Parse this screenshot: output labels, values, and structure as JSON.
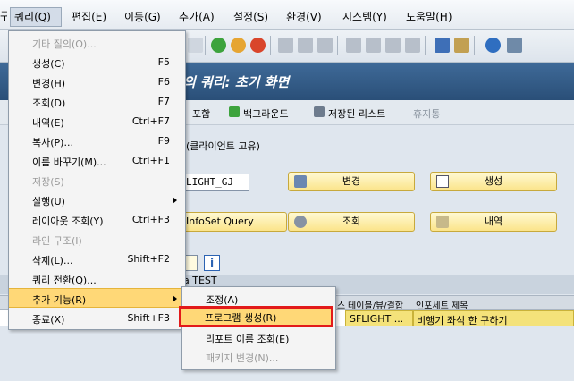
{
  "menubar": {
    "left_fragment": "구",
    "items": [
      "쿼리(Q)",
      "편집(E)",
      "이동(G)",
      "추가(A)",
      "설정(S)",
      "환경(V)",
      "시스템(Y)",
      "도움말(H)"
    ]
  },
  "title": "의 쿼리: 초기 화면",
  "apptoolbar": {
    "include": "포함",
    "background": "백그라운드",
    "saved_list": "저장된 리스트",
    "trash": "휴지통"
  },
  "work": {
    "client_label": "(클라이언트 고유)",
    "query_field": "LIGHT_GJ",
    "infoset_button": "InfoSet Query",
    "change_button": "변경",
    "create_button": "생성",
    "display_button": "조회",
    "description_button": "내역"
  },
  "table": {
    "title_fragment": "a TEST",
    "headers": [
      "스",
      "테이블/뷰/결합",
      "인포세트 제목"
    ],
    "row": [
      "SFLIGHT ...",
      "비행기 좌석 한 구하기"
    ]
  },
  "dropdown": {
    "items": [
      {
        "label": "기타 질의(O)...",
        "shortcut": "",
        "disabled": true,
        "arrow": false
      },
      {
        "label": "생성(C)",
        "shortcut": "F5",
        "disabled": false,
        "arrow": false
      },
      {
        "label": "변경(H)",
        "shortcut": "F6",
        "disabled": false,
        "arrow": false
      },
      {
        "label": "조회(D)",
        "shortcut": "F7",
        "disabled": false,
        "arrow": false
      },
      {
        "label": "내역(E)",
        "shortcut": "Ctrl+F7",
        "disabled": false,
        "arrow": false
      },
      {
        "label": "복사(P)...",
        "shortcut": "F9",
        "disabled": false,
        "arrow": false
      },
      {
        "label": "이름 바꾸기(M)...",
        "shortcut": "Ctrl+F1",
        "disabled": false,
        "arrow": false
      },
      {
        "label": "저장(S)",
        "shortcut": "",
        "disabled": true,
        "arrow": false
      },
      {
        "label": "실행(U)",
        "shortcut": "",
        "disabled": false,
        "arrow": true
      },
      {
        "label": "레이아웃 조회(Y)",
        "shortcut": "Ctrl+F3",
        "disabled": false,
        "arrow": false
      },
      {
        "label": "라인 구조(I)",
        "shortcut": "",
        "disabled": true,
        "arrow": false
      },
      {
        "label": "삭제(L)...",
        "shortcut": "Shift+F2",
        "disabled": false,
        "arrow": false
      },
      {
        "label": "쿼리 전환(Q)...",
        "shortcut": "",
        "disabled": false,
        "arrow": false
      },
      {
        "label": "추가 기능(R)",
        "shortcut": "",
        "disabled": false,
        "arrow": true,
        "highlight": true
      },
      {
        "label": "종료(X)",
        "shortcut": "Shift+F3",
        "disabled": false,
        "arrow": false
      }
    ]
  },
  "submenu": {
    "items": [
      {
        "label": "조정(A)",
        "disabled": false
      },
      {
        "label": "프로그램 생성(R)",
        "disabled": false,
        "highlight": true
      },
      {
        "label": "리포트 이름 조회(E)",
        "disabled": false
      },
      {
        "label": "패키지 변경(N)...",
        "disabled": true
      }
    ]
  },
  "colors": {
    "title_bg": "#2f5783",
    "menu_highlight": "#ffd877",
    "focus_border": "#e21a1a",
    "button_yellow": "#fbe48a"
  }
}
